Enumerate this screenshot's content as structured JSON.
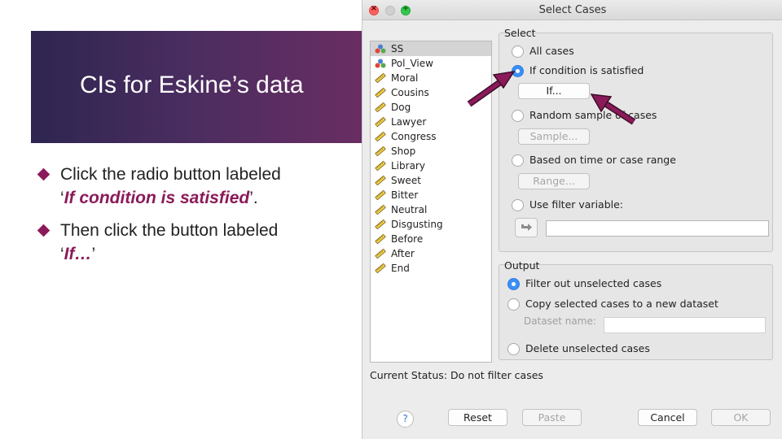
{
  "slide": {
    "title": "CIs for Eskine’s data",
    "bullets": [
      {
        "text_before": "Click the radio button labeled",
        "text_line2_open": "‘",
        "emph": "If condition is satisfied",
        "text_line2_close": "’."
      },
      {
        "text_before": "Then click the button labeled",
        "text_line2_open": "‘",
        "emph": "If…",
        "text_line2_close": "’"
      }
    ]
  },
  "dialog": {
    "title": "Select Cases",
    "variables": [
      {
        "name": "SS",
        "icon": "nominal-icon",
        "selected": true
      },
      {
        "name": "Pol_View",
        "icon": "nominal-icon",
        "selected": false
      },
      {
        "name": "Moral",
        "icon": "scale-ruler-icon"
      },
      {
        "name": "Cousins",
        "icon": "scale-ruler-icon"
      },
      {
        "name": "Dog",
        "icon": "scale-ruler-icon"
      },
      {
        "name": "Lawyer",
        "icon": "scale-ruler-icon"
      },
      {
        "name": "Congress",
        "icon": "scale-ruler-icon"
      },
      {
        "name": "Shop",
        "icon": "scale-ruler-icon"
      },
      {
        "name": "Library",
        "icon": "scale-ruler-icon"
      },
      {
        "name": "Sweet",
        "icon": "scale-ruler-icon"
      },
      {
        "name": "Bitter",
        "icon": "scale-ruler-icon"
      },
      {
        "name": "Neutral",
        "icon": "scale-ruler-icon"
      },
      {
        "name": "Disgusting",
        "icon": "scale-ruler-icon"
      },
      {
        "name": "Before",
        "icon": "scale-ruler-icon"
      },
      {
        "name": "After",
        "icon": "scale-ruler-icon"
      },
      {
        "name": "End",
        "icon": "scale-ruler-icon"
      }
    ],
    "select": {
      "label": "Select",
      "all_cases": "All cases",
      "if_condition": "If condition is satisfied",
      "if_button": "If...",
      "random_sample": "Random sample of cases",
      "sample_button": "Sample...",
      "time_range": "Based on time or case range",
      "range_button": "Range...",
      "filter_variable": "Use filter variable:",
      "filter_value": ""
    },
    "output": {
      "label": "Output",
      "filter_out": "Filter out unselected cases",
      "copy_new": "Copy selected cases to a new dataset",
      "dataset_name_label": "Dataset name:",
      "dataset_name_value": "",
      "delete": "Delete unselected cases"
    },
    "status": "Current Status: Do not filter cases",
    "buttons": {
      "help": "?",
      "reset": "Reset",
      "paste": "Paste",
      "cancel": "Cancel",
      "ok": "OK"
    },
    "colors": {
      "accent": "#3b8ff6",
      "annotation_arrow": "#8b1a5a"
    }
  }
}
